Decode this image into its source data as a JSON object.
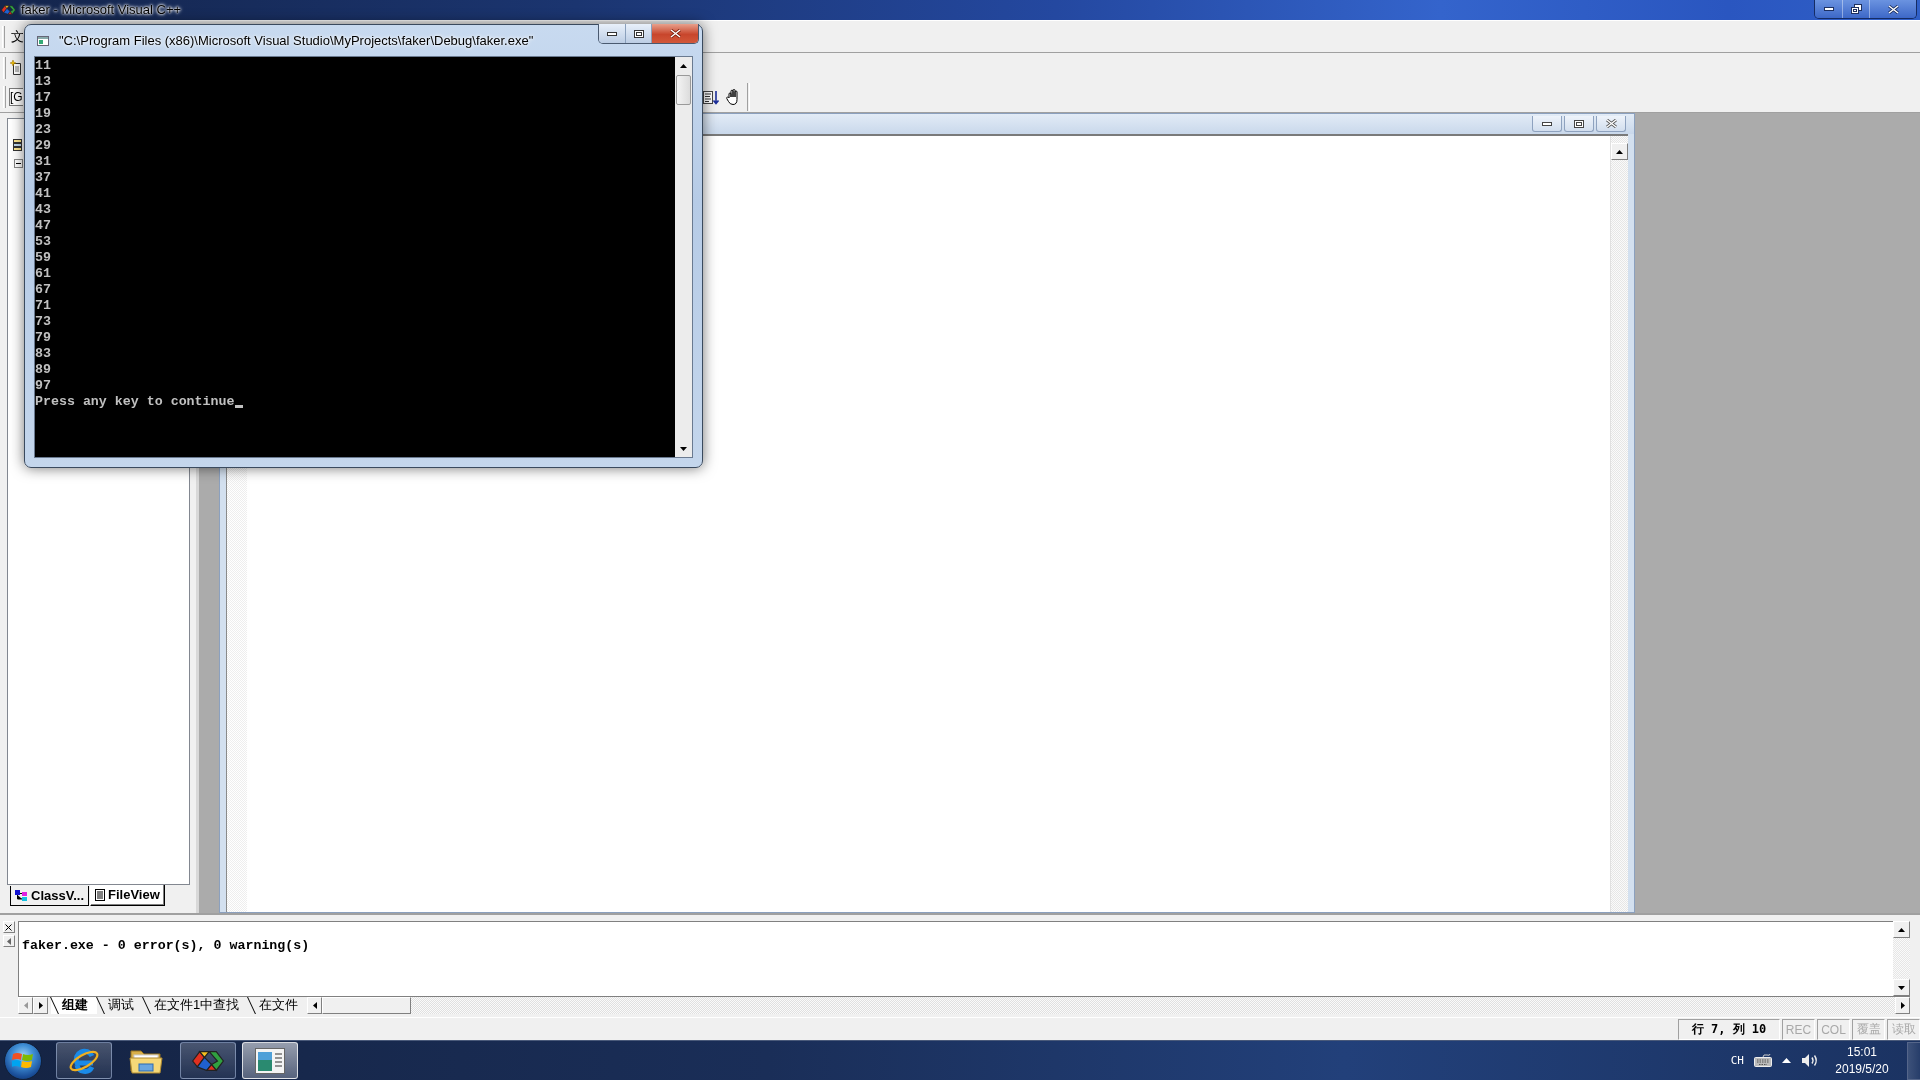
{
  "ide_window": {
    "title": "faker - Microsoft Visual C++"
  },
  "menu_bar": {
    "items": [
      "文"
    ]
  },
  "toolbar": {
    "combo_value": "[G"
  },
  "workspace": {
    "tabs": [
      {
        "label": "ClassV...",
        "selected": false
      },
      {
        "label": "FileView",
        "selected": true
      }
    ]
  },
  "output": {
    "text": "faker.exe - 0 error(s), 0 warning(s)",
    "tabs": [
      {
        "label": "组建",
        "selected": true
      },
      {
        "label": "调试",
        "selected": false
      },
      {
        "label": "在文件1中查找",
        "selected": false
      },
      {
        "label": "在文件",
        "selected": false
      }
    ]
  },
  "status_bar": {
    "position": "行 7, 列 10",
    "indicators": [
      {
        "label": "REC",
        "on": false
      },
      {
        "label": "COL",
        "on": false
      },
      {
        "label": "覆盖",
        "on": false
      },
      {
        "label": "读取",
        "on": false
      }
    ]
  },
  "taskbar": {
    "buttons": [
      {
        "kind": "browser",
        "running": true,
        "selected": false
      },
      {
        "kind": "folder",
        "running": false,
        "selected": false
      },
      {
        "kind": "ide",
        "running": true,
        "selected": false
      },
      {
        "kind": "console",
        "running": true,
        "selected": true
      }
    ],
    "tray": {
      "language": "CH",
      "time": "15:01",
      "date": "2019/5/20"
    }
  },
  "console_window": {
    "title": "\"C:\\Program Files (x86)\\Microsoft Visual Studio\\MyProjects\\faker\\Debug\\faker.exe\"",
    "lines": [
      "11",
      "13",
      "17",
      "19",
      "23",
      "29",
      "31",
      "37",
      "41",
      "43",
      "47",
      "53",
      "59",
      "61",
      "67",
      "71",
      "73",
      "79",
      "83",
      "89",
      "97",
      "Press any key to continue"
    ],
    "cursor": true
  }
}
